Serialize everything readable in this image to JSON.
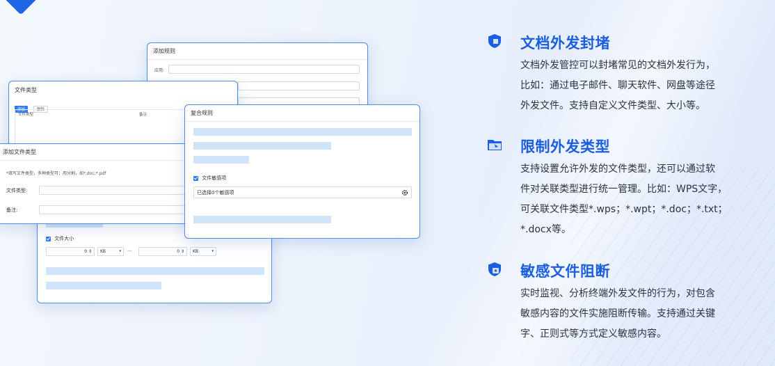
{
  "windows": {
    "add_rule": {
      "title": "添加规则",
      "app_label": "应用:"
    },
    "file_type": {
      "title": "文件类型",
      "add_label": "添加",
      "delete_label": "删除",
      "col_type": "文件类型",
      "col_note": "备注"
    },
    "add_file_type": {
      "title": "添加文件类型",
      "hint": "*填写文件类型，多种类型可；用分割，如*.doc;*.pdf",
      "type_label": "文件类型:",
      "note_label": "备注:"
    },
    "compound_rule": {
      "title": "复合规则",
      "sensitive_label": "文件敏感项",
      "sensitive_value": "已选择0个敏感项"
    },
    "file_size": {
      "label": "文件大小",
      "min_value": "0",
      "min_unit": "KB",
      "max_value": "0",
      "max_unit": "KB",
      "separator": "—"
    }
  },
  "features": [
    {
      "icon": "shield-icon",
      "title": "文档外发封堵",
      "lines": [
        "文档外发管控可以封堵常见的文档外发行为，",
        "比如：通过电子邮件、聊天软件、网盘等途径",
        "外发文件。支持自定义文件类型、大小等。"
      ]
    },
    {
      "icon": "folder-icon",
      "title": "限制外发类型",
      "lines": [
        "支持设置允许外发的文件类型，还可以通过软",
        "件对关联类型进行统一管理。比如：WPS文字，",
        "可关联文件类型*.wps；*.wpt；*.doc；*.txt；",
        "*.docx等。"
      ]
    },
    {
      "icon": "shield-lock-icon",
      "title": "敏感文件阻断",
      "lines": [
        "实时监视、分析终端外发文件的行为，对包含",
        "敏感内容的文件实施阻断传输。支持通过关键",
        "字、正则式等方式定义敏感内容。"
      ]
    }
  ],
  "colors": {
    "accent": "#1b5fe0",
    "window_border": "#4a8cf0",
    "placeholder_bar": "#cfe3f9"
  }
}
